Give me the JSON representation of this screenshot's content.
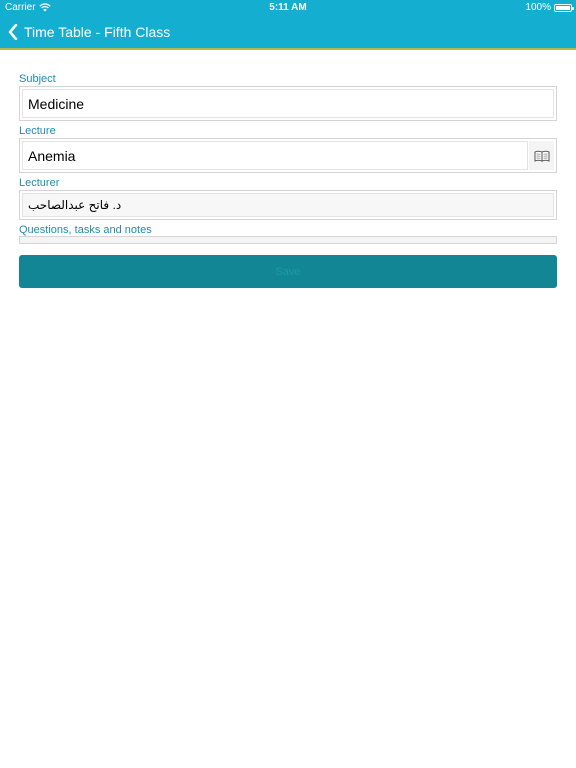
{
  "status_bar": {
    "carrier": "Carrier",
    "time": "5:11 AM",
    "battery": "100%",
    "icons": [
      "wifi-icon",
      "battery-icon"
    ]
  },
  "nav": {
    "title": "Time Table - Fifth Class",
    "back_icon": "chevron-left-icon"
  },
  "form": {
    "subject_label": "Subject",
    "subject_value": "Medicine",
    "lecture_label": "Lecture",
    "lecture_value": "Anemia",
    "lecture_button_icon": "book-icon",
    "lecturer_label": "Lecturer",
    "lecturer_value": "د. فاتح عبدالصاحب",
    "notes_label": "Questions, tasks and notes",
    "notes_value": "",
    "save_label": "Save"
  },
  "colors": {
    "header": "#14aed0",
    "accent_text": "#1a8fae",
    "button": "#138696",
    "header_underline": "#b5b64a"
  }
}
